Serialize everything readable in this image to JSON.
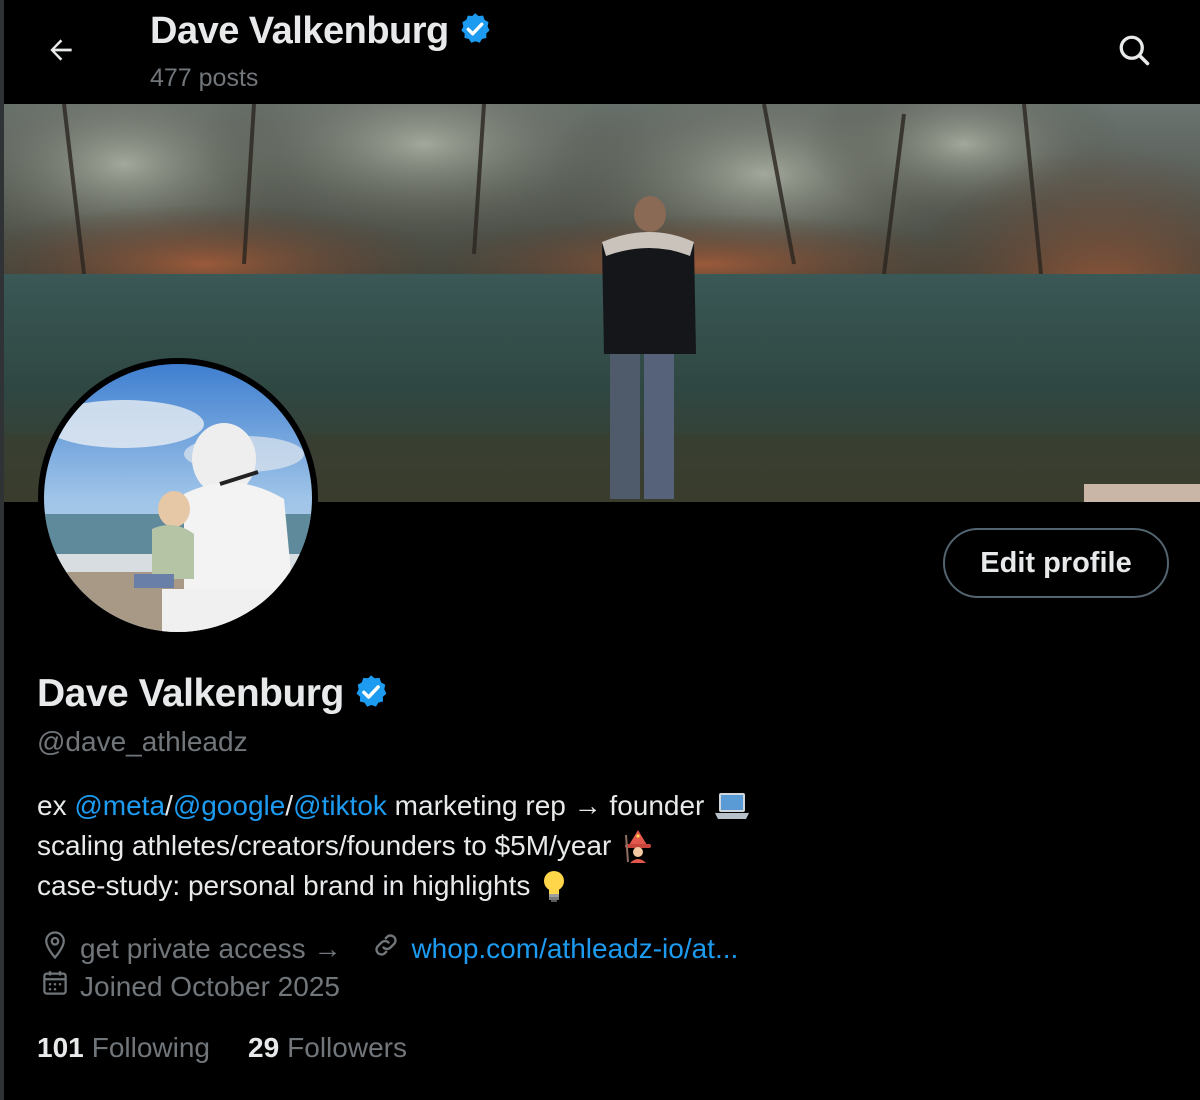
{
  "header": {
    "name": "Dave Valkenburg",
    "posts": "477 posts",
    "back_icon": "arrow-left-icon",
    "search_icon": "search-icon"
  },
  "profile": {
    "name": "Dave Valkenburg",
    "handle": "@dave_athleadz",
    "verified": true,
    "edit_label": "Edit profile"
  },
  "bio": {
    "line1": {
      "prefix": "ex ",
      "mention1": "@meta",
      "sep1": "/",
      "mention2": "@google",
      "sep2": "/",
      "mention3": "@tiktok",
      "suffix": " marketing rep → founder",
      "emoji": "laptop-icon"
    },
    "line2": {
      "text": "scaling athletes/creators/founders to $5M/year",
      "emoji": "wizard-icon"
    },
    "line3": {
      "text": "case-study: personal brand in highlights",
      "emoji": "lightbulb-icon"
    }
  },
  "meta": {
    "location": "get private access →",
    "website": "whop.com/athleadz-io/at...",
    "joined": "Joined October 2025"
  },
  "stats": {
    "following_count": "101",
    "following_label": "Following",
    "followers_count": "29",
    "followers_label": "Followers"
  },
  "colors": {
    "background": "#000000",
    "text": "#e7e9ea",
    "muted": "#71767b",
    "accent": "#1d9bf0",
    "border": "#536471"
  }
}
